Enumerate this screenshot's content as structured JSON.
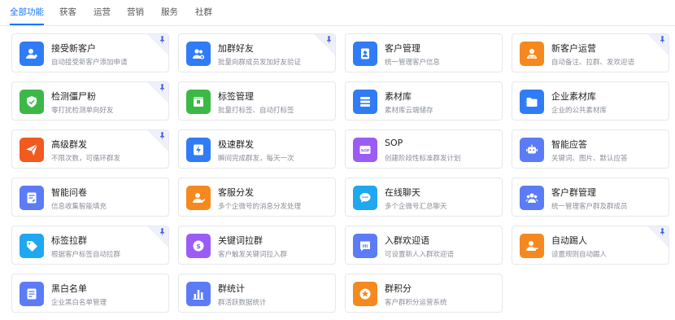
{
  "tabs": [
    {
      "label": "全部功能",
      "active": true
    },
    {
      "label": "获客",
      "active": false
    },
    {
      "label": "运营",
      "active": false
    },
    {
      "label": "营销",
      "active": false
    },
    {
      "label": "服务",
      "active": false
    },
    {
      "label": "社群",
      "active": false
    }
  ],
  "cards": [
    {
      "title": "接受新客户",
      "desc": "自动接受新客户添加申请",
      "icon": "user-add-icon",
      "color": "#2f7cf6",
      "pinned": true
    },
    {
      "title": "加群好友",
      "desc": "批量向群成员发加好友验证",
      "icon": "group-add-icon",
      "color": "#2f7cf6",
      "pinned": true
    },
    {
      "title": "客户管理",
      "desc": "统一管理客户信息",
      "icon": "contact-book-icon",
      "color": "#2f7cf6",
      "pinned": false
    },
    {
      "title": "新客户运营",
      "desc": "自动备注、拉群、发欢迎语",
      "icon": "new-customer-icon",
      "color": "#f5891f",
      "pinned": true
    },
    {
      "title": "检测僵尸粉",
      "desc": "零打扰检测单向好友",
      "icon": "shield-check-icon",
      "color": "#3cb846",
      "pinned": true
    },
    {
      "title": "标签管理",
      "desc": "批量打标签、自动打标签",
      "icon": "tag-card-icon",
      "color": "#3cb846",
      "pinned": false
    },
    {
      "title": "素材库",
      "desc": "素材库云端储存",
      "icon": "stack-icon",
      "color": "#2f7cf6",
      "pinned": false
    },
    {
      "title": "企业素材库",
      "desc": "企业的公共素材库",
      "icon": "folder-icon",
      "color": "#2f7cf6",
      "pinned": false
    },
    {
      "title": "高级群发",
      "desc": "不限次数，可循环群发",
      "icon": "send-icon",
      "color": "#f25a1f",
      "pinned": true
    },
    {
      "title": "极速群发",
      "desc": "瞬间完成群发，每天一次",
      "icon": "lightning-icon",
      "color": "#2f7cf6",
      "pinned": false
    },
    {
      "title": "SOP",
      "desc": "创建阶段性标准群发计划",
      "icon": "sop-icon",
      "color": "#9b5cf6",
      "pinned": false
    },
    {
      "title": "智能应答",
      "desc": "关键词、图片、默认应答",
      "icon": "robot-icon",
      "color": "#5b7cf6",
      "pinned": false
    },
    {
      "title": "智能问卷",
      "desc": "信息收集智能填充",
      "icon": "form-icon",
      "color": "#5b7cf6",
      "pinned": false
    },
    {
      "title": "客服分发",
      "desc": "多个企微号的消息分发处理",
      "icon": "service-user-icon",
      "color": "#f5891f",
      "pinned": false
    },
    {
      "title": "在线聊天",
      "desc": "多个企微号汇总聊天",
      "icon": "chat-icon",
      "color": "#1fa7f0",
      "pinned": false
    },
    {
      "title": "客户群管理",
      "desc": "统一管理客户群及群成员",
      "icon": "group-icon",
      "color": "#5b7cf6",
      "pinned": false
    },
    {
      "title": "标签拉群",
      "desc": "根据客户标签自动拉群",
      "icon": "tag-icon",
      "color": "#1fa7f0",
      "pinned": true
    },
    {
      "title": "关键词拉群",
      "desc": "客户触发关键词拉入群",
      "icon": "keyword-icon",
      "color": "#9b5cf6",
      "pinned": false
    },
    {
      "title": "入群欢迎语",
      "desc": "可设置新人入群欢迎语",
      "icon": "hi-icon",
      "color": "#5b7cf6",
      "pinned": false
    },
    {
      "title": "自动踢人",
      "desc": "设置规则自动踢人",
      "icon": "user-remove-icon",
      "color": "#f5891f",
      "pinned": true
    },
    {
      "title": "黑白名单",
      "desc": "企业黑白名单管理",
      "icon": "list-icon",
      "color": "#5b7cf6",
      "pinned": false
    },
    {
      "title": "群统计",
      "desc": "群活跃数据统计",
      "icon": "bar-chart-icon",
      "color": "#5b7cf6",
      "pinned": false
    },
    {
      "title": "群积分",
      "desc": "客户群积分运营系统",
      "icon": "points-icon",
      "color": "#f5891f",
      "pinned": false
    }
  ]
}
